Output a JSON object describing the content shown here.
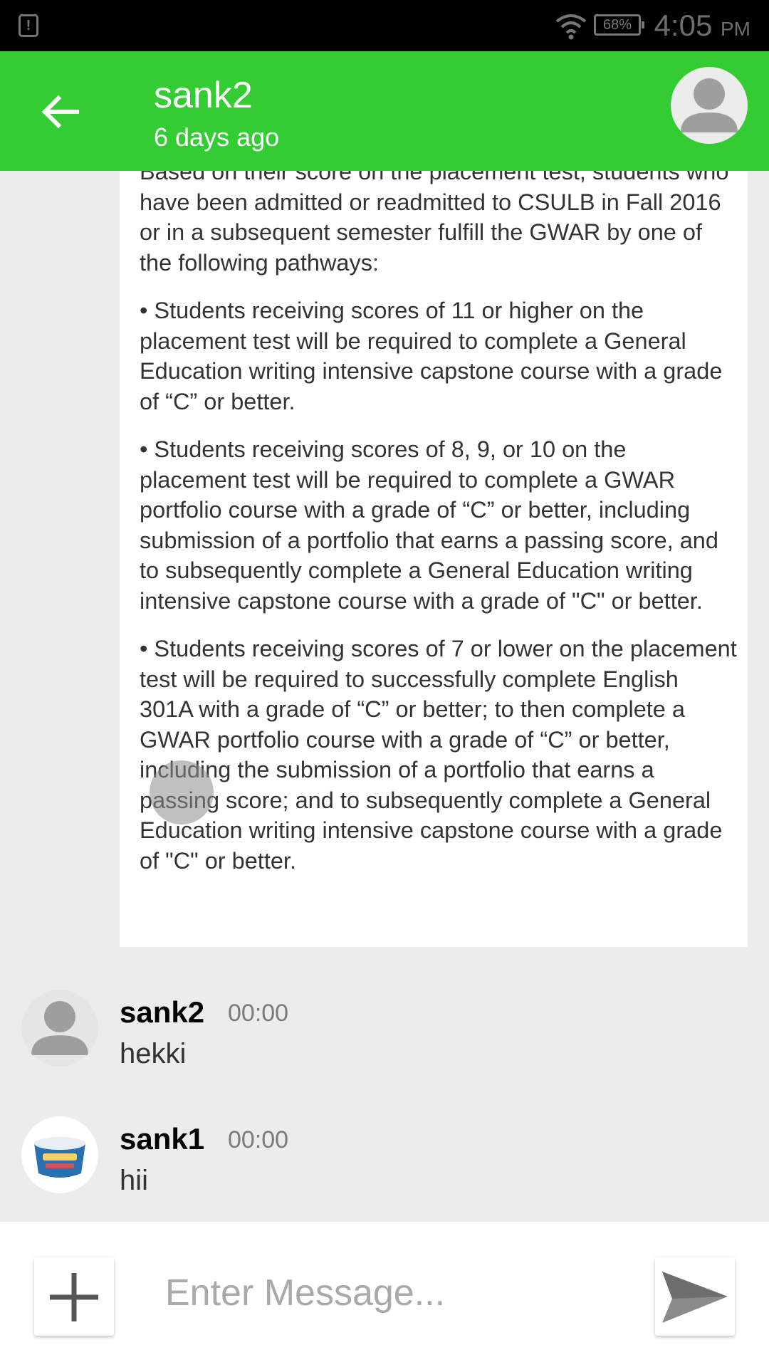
{
  "status_bar": {
    "battery": "68%",
    "time": "4:05",
    "ampm": "PM"
  },
  "header": {
    "title": "sank2",
    "subtitle": "6 days ago"
  },
  "message_card": {
    "paragraphs": [
      "Based on their score on the placement test, students who have been admitted or readmitted to CSULB in Fall 2016 or in a subsequent semester fulfill the GWAR by one of the following pathways:",
      "• Students receiving scores of 11 or higher on the placement test will be required to complete a General Education writing intensive capstone course with a grade of “C” or better.",
      "• Students receiving scores of 8, 9, or 10 on the placement test will be required to complete a GWAR portfolio course with a grade of “C” or better, including submission of a portfolio that earns a passing score, and to subsequently complete a General Education writing intensive capstone course with a grade of \"C\" or better.",
      "• Students receiving scores of 7 or lower on the placement test will be required to successfully complete English 301A with a grade of “C” or better; to then complete a GWAR portfolio course with a grade of “C” or better, including the submission of a portfolio that earns a passing score; and to subsequently complete a General Education writing intensive capstone course with a grade of \"C\" or better."
    ]
  },
  "messages": [
    {
      "sender": "sank2",
      "time": "00:00",
      "text": "hekki",
      "avatar": "default-user-avatar"
    },
    {
      "sender": "sank1",
      "time": "00:00",
      "text": "hii",
      "avatar": "almondmilk-carton-avatar"
    }
  ],
  "composer": {
    "placeholder": "Enter Message...",
    "add_icon": "plus-icon",
    "send_icon": "send-arrow-icon"
  },
  "colors": {
    "app_bar": "#33cc33",
    "background": "#ececec"
  }
}
